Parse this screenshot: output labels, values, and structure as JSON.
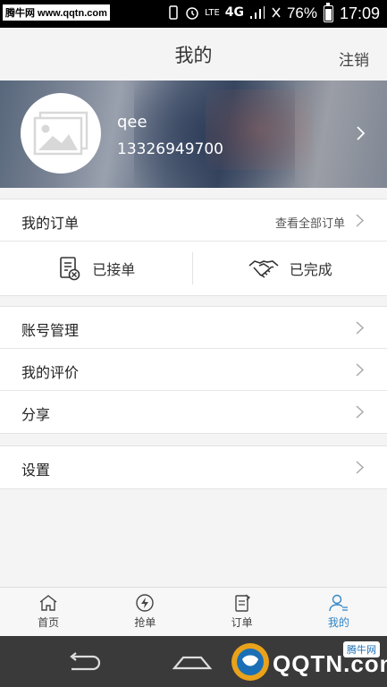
{
  "status_bar": {
    "watermark": "腾牛网 www.qqtn.com",
    "network_label": "LTE",
    "network_type": "4G",
    "battery": "76%",
    "battery_level": 0.76,
    "time": "17:09"
  },
  "header": {
    "title": "我的",
    "logout_label": "注销"
  },
  "profile": {
    "username": "qee",
    "phone": "13326949700"
  },
  "orders": {
    "title": "我的订单",
    "view_all": "查看全部订单",
    "tabs": [
      {
        "label": "已接单",
        "icon": "accepted-order-icon"
      },
      {
        "label": "已完成",
        "icon": "handshake-icon"
      }
    ]
  },
  "menu": {
    "items": [
      {
        "label": "账号管理"
      },
      {
        "label": "我的评价"
      },
      {
        "label": "分享"
      }
    ],
    "settings": {
      "label": "设置"
    }
  },
  "tabbar": {
    "active_color": "#2f86c6",
    "tabs": [
      {
        "label": "首页",
        "icon": "home-icon"
      },
      {
        "label": "抢单",
        "icon": "lightning-icon"
      },
      {
        "label": "订单",
        "icon": "order-icon"
      },
      {
        "label": "我的",
        "icon": "user-icon"
      }
    ]
  },
  "nav_overlay": {
    "brand": "QQTN.com",
    "badge": "腾牛网"
  }
}
